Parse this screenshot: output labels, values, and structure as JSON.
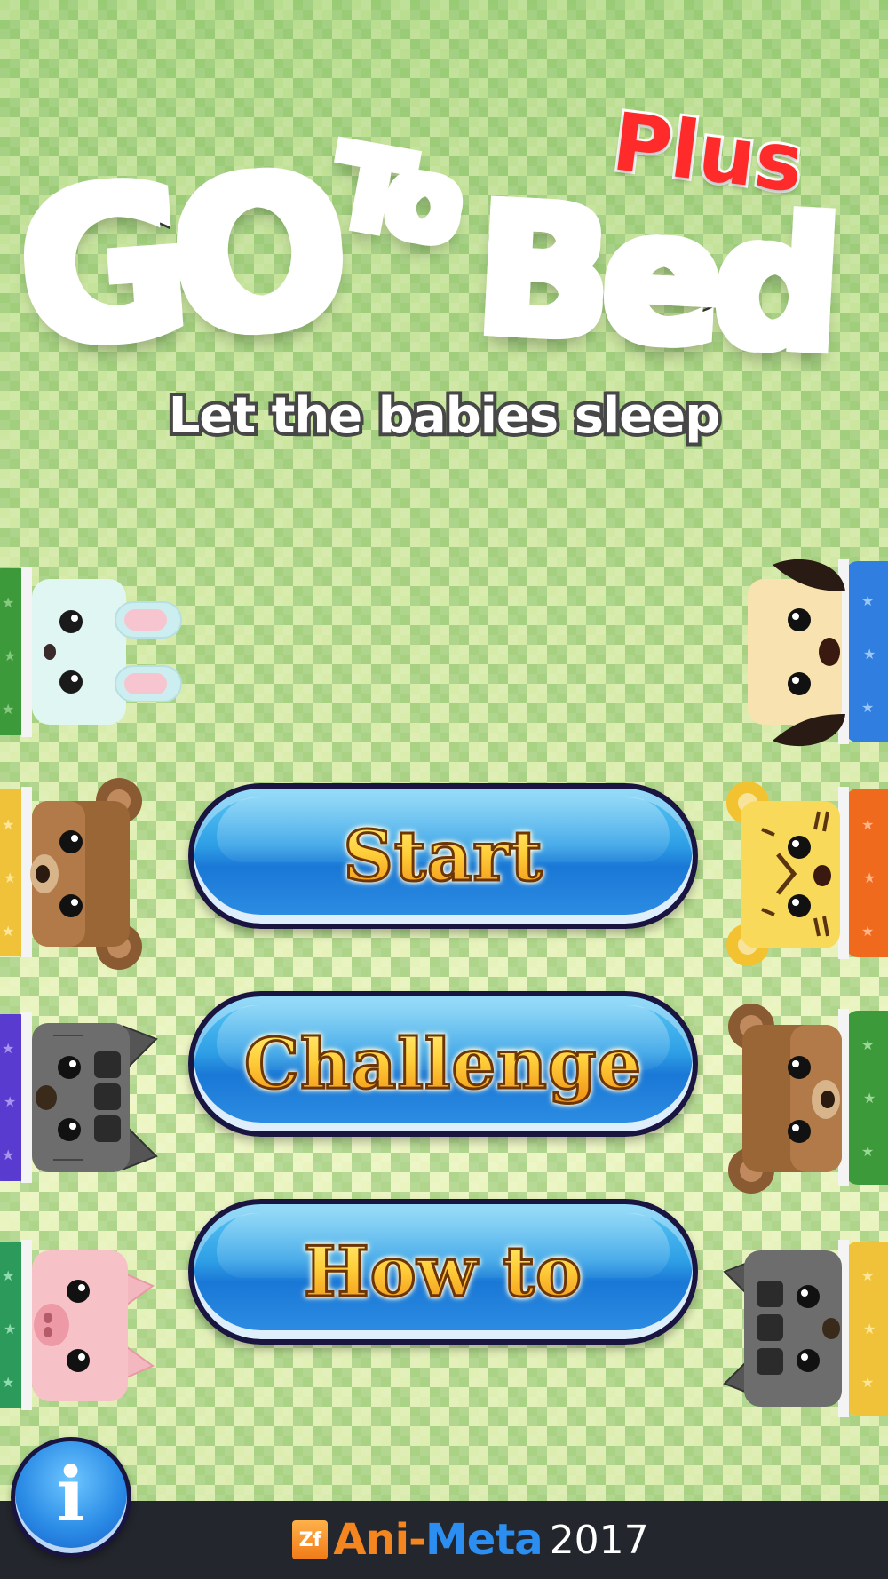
{
  "logo": {
    "go": "GO",
    "to": "To",
    "bed": "Bed",
    "plus": "Plus",
    "tagline": "Let the babies sleep"
  },
  "menu": {
    "start": "Start",
    "challenge": "Challenge",
    "how_to": "How to"
  },
  "info_button": {
    "glyph": "i",
    "icon": "info-icon"
  },
  "footer": {
    "brand_mark": "Zf",
    "brand_name_part1": "Ani-",
    "brand_name_part2": "Meta",
    "year": "2017"
  },
  "animals": {
    "left": [
      "bunny",
      "bear",
      "cat",
      "pig"
    ],
    "right": [
      "puppy",
      "tiger",
      "bear",
      "cat"
    ]
  },
  "colors": {
    "button_blue": "#2e9fe6",
    "button_text_gold": "#ffcf3a",
    "logo_go_blue": "#4fc3f7",
    "logo_to_orange": "#f0612a",
    "logo_bed_green": "#2fd655",
    "logo_plus_red": "#ff2a2a",
    "footer_bg": "#23262c",
    "brand_orange": "#f5851f",
    "brand_blue": "#2b8ef0"
  }
}
